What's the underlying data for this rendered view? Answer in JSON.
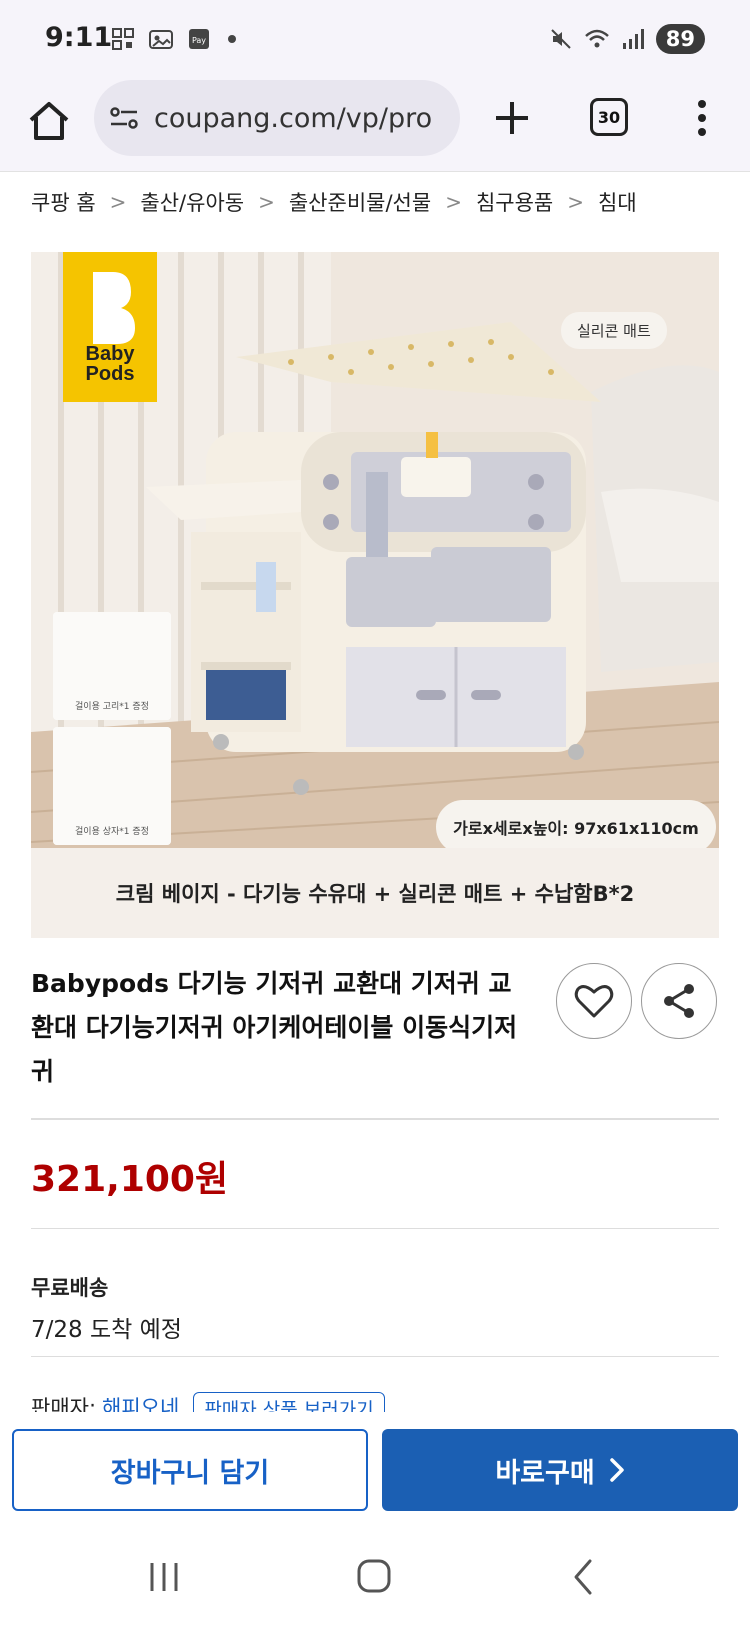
{
  "status_bar": {
    "time": "9:11",
    "battery": "89",
    "icons": [
      "qr-icon",
      "image-icon",
      "pay-icon",
      "dot-icon",
      "mute-icon",
      "wifi-icon",
      "signal-icon"
    ]
  },
  "browser": {
    "url": "coupang.com/vp/pro",
    "tab_count": "30"
  },
  "breadcrumb": [
    "쿠팡 홈",
    "출산/유아동",
    "출산준비물/선물",
    "침구용품",
    "침대"
  ],
  "product_image": {
    "brand_logo_text": "Baby Pods",
    "mat_label": "실리콘 매트",
    "dimensions": "가로x세로x높이: 97x61x110cm",
    "thumb1_label": "걸이용 고리*1 증정",
    "thumb2_label": "걸이용 상자*1 증정",
    "caption": "크림 베이지 - 다기능 수유대 + 실리콘 매트 + 수납함B*2"
  },
  "product": {
    "title": "Babypods 다기능 기저귀 교환대 기저귀 교환대 다기능기저귀 아기케어테이블 이동식기저귀",
    "price": "321,100원",
    "shipping_label": "무료배송",
    "eta": "7/28 도착 예정",
    "seller_label": "판매자:",
    "seller_name": "해피오네",
    "seller_products_button": "판매자 상품 보러가기"
  },
  "actions": {
    "cart_label": "장바구니 담기",
    "buy_label": "바로구매"
  },
  "colors": {
    "price": "#ae0000",
    "primary": "#1b5fb3",
    "link": "#1761c6"
  }
}
